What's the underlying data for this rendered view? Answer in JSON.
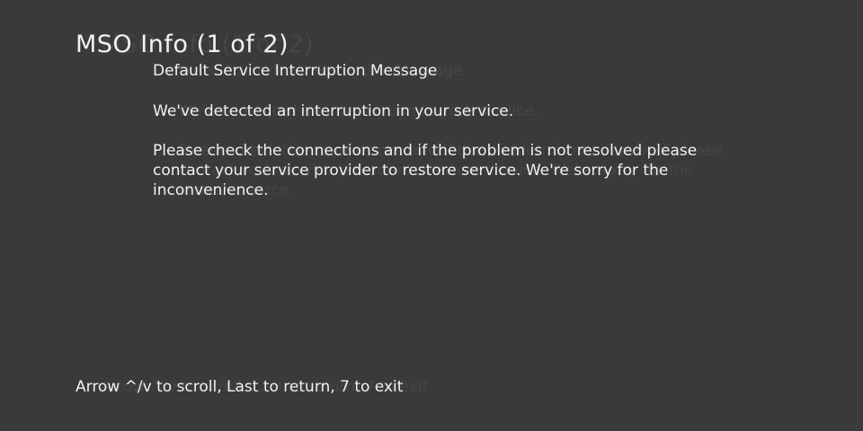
{
  "screen": {
    "title": "MSO Info (1 of 2)",
    "subtitle": "Default Service Interruption Message",
    "paragraphs": [
      "We've detected an interruption in your service.",
      "Please check the connections and if the problem is not resolved please contact your service provider to restore service. We're sorry for the inconvenience."
    ],
    "footer_hint": "Arrow ^/v to scroll, Last to return, 7 to exit"
  },
  "colors": {
    "background": "#3a3a3a",
    "text": "#f2f2f2"
  }
}
